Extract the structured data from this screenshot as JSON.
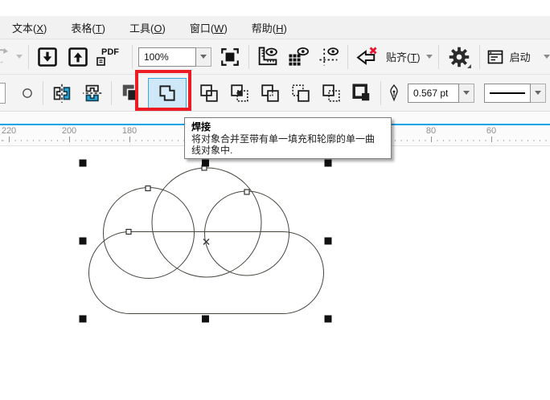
{
  "menu_bar": {
    "items": [
      {
        "pre": "文本(",
        "key": "X",
        "post": ")"
      },
      {
        "pre": "表格(",
        "key": "T",
        "post": ")"
      },
      {
        "pre": "工具(",
        "key": "O",
        "post": ")"
      },
      {
        "pre": "窗口(",
        "key": "W",
        "post": ")"
      },
      {
        "pre": "帮助(",
        "key": "H",
        "post": ")"
      }
    ]
  },
  "standard_toolbar": {
    "pdf_label": "PDF",
    "zoom_value": "100%",
    "snap": {
      "pre": "贴齐(",
      "key": "T",
      "post": ")"
    },
    "launch_label": "启动",
    "icons": [
      "redo-arrow",
      "import",
      "export",
      "pdf-export",
      "zoom-level-combo",
      "full-screen-preview",
      "show-rulers",
      "show-grid",
      "show-guidelines",
      "treat-as-filled",
      "snap-to-menu",
      "options-gear",
      "launcher-window"
    ]
  },
  "property_bar": {
    "outline_width_value": "0.567 pt",
    "icons": [
      "fill-swatch",
      "ellipse-indicator",
      "mirror-horizontal",
      "mirror-vertical",
      "combine",
      "weld",
      "trim",
      "intersect",
      "simplify",
      "front-minus-back",
      "back-minus-front",
      "create-boundary",
      "outline-pen",
      "outline-width-combo",
      "line-style-combo"
    ]
  },
  "tooltip": {
    "title": "焊接",
    "body_line1": "将对象合并至带有单一填充和轮廓的单一曲",
    "body_line2": "线对象中."
  },
  "ruler": {
    "labels": [
      "220",
      "200",
      "180",
      "80",
      "60"
    ]
  },
  "colors": {
    "accent_blue": "#00a3e8",
    "icon_cyan": "#29abe2",
    "highlight_red": "#ed1c24",
    "weld_button_bg": "#cfe8f8",
    "weld_button_border": "#3da7dd"
  }
}
